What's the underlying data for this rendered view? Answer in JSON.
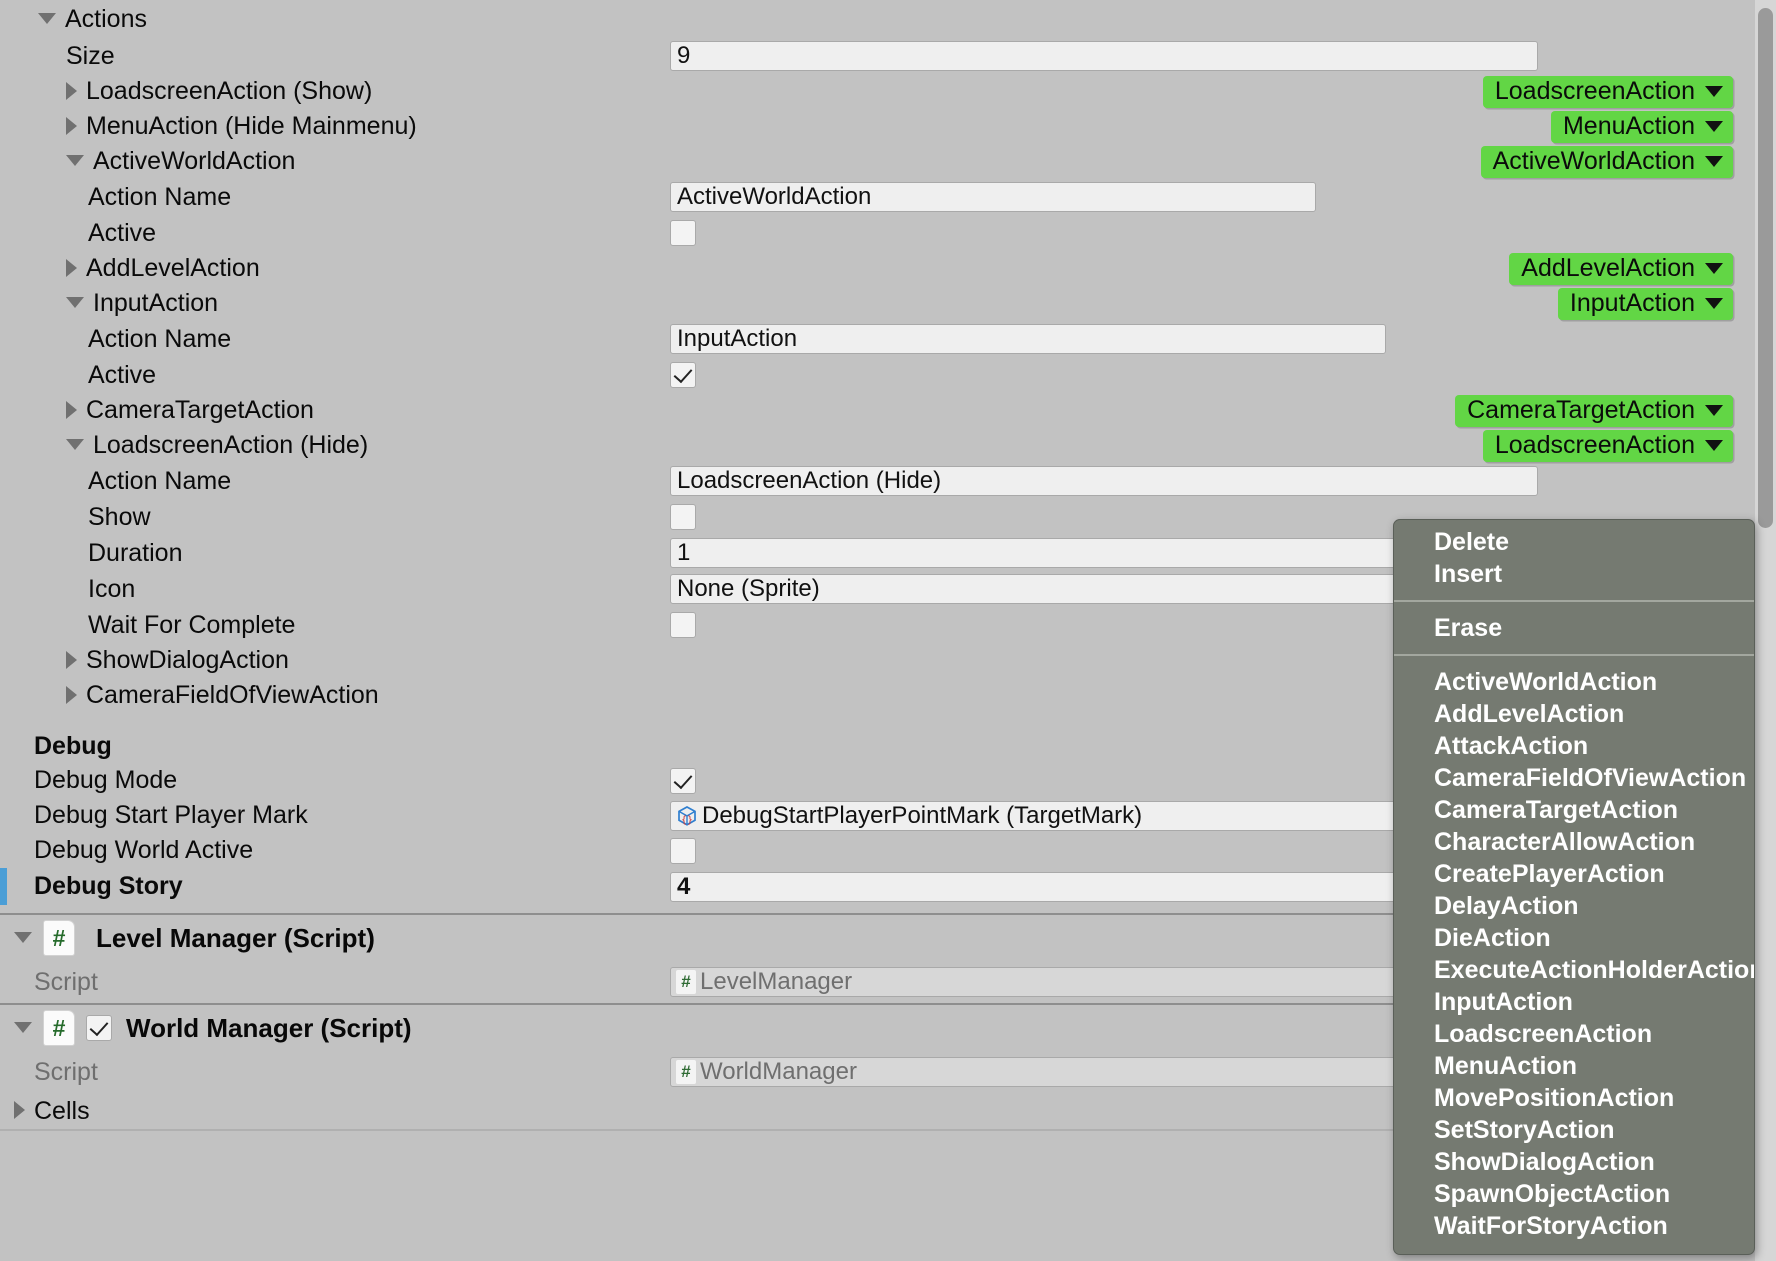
{
  "inspector": {
    "array_header": {
      "label": "Actions",
      "expanded": true
    },
    "size_row": {
      "label": "Size",
      "value": "9"
    },
    "elements": [
      {
        "label": "LoadscreenAction (Show)",
        "expanded": false,
        "type_button": "LoadscreenAction"
      },
      {
        "label": "MenuAction (Hide Mainmenu)",
        "expanded": false,
        "type_button": "MenuAction"
      },
      {
        "label": "ActiveWorldAction",
        "expanded": true,
        "type_button": "ActiveWorldAction",
        "fields": [
          {
            "label": "Action Name",
            "widget": "text",
            "value": "ActiveWorldAction"
          },
          {
            "label": "Active",
            "widget": "checkbox",
            "value": false
          }
        ]
      },
      {
        "label": "AddLevelAction",
        "expanded": false,
        "type_button": "AddLevelAction"
      },
      {
        "label": "InputAction",
        "expanded": true,
        "type_button": "InputAction",
        "fields": [
          {
            "label": "Action Name",
            "widget": "text",
            "value": "InputAction"
          },
          {
            "label": "Active",
            "widget": "checkbox",
            "value": true
          }
        ]
      },
      {
        "label": "CameraTargetAction",
        "expanded": false,
        "type_button": "CameraTargetAction"
      },
      {
        "label": "LoadscreenAction (Hide)",
        "expanded": true,
        "type_button": "LoadscreenAction",
        "fields": [
          {
            "label": "Action Name",
            "widget": "text",
            "value": "LoadscreenAction (Hide)"
          },
          {
            "label": "Show",
            "widget": "checkbox",
            "value": false
          },
          {
            "label": "Duration",
            "widget": "text",
            "value": "1"
          },
          {
            "label": "Icon",
            "widget": "text",
            "value": "None (Sprite)"
          },
          {
            "label": "Wait For Complete",
            "widget": "checkbox",
            "value": false
          }
        ]
      },
      {
        "label": "ShowDialogAction",
        "expanded": false,
        "type_button": null
      },
      {
        "label": "CameraFieldOfViewAction",
        "expanded": false,
        "type_button": null
      }
    ],
    "debug_section": {
      "header": "Debug",
      "rows": [
        {
          "label": "Debug Mode",
          "widget": "checkbox",
          "value": true,
          "bold": false,
          "override": false
        },
        {
          "label": "Debug Start Player Mark",
          "widget": "object",
          "value": "DebugStartPlayerPointMark (TargetMark)",
          "icon": "prefab-icon",
          "bold": false,
          "override": false
        },
        {
          "label": "Debug World Active",
          "widget": "checkbox",
          "value": false,
          "bold": false,
          "override": false
        },
        {
          "label": "Debug Story",
          "widget": "text",
          "value": "4",
          "bold": true,
          "override": true
        }
      ]
    },
    "components": [
      {
        "title": "Level Manager (Script)",
        "expanded": true,
        "has_enable_checkbox": false,
        "enabled": false,
        "icon": "cs-script-icon",
        "rows": [
          {
            "label": "Script",
            "widget": "object-readonly",
            "value": "LevelManager",
            "icon": "cs-script-icon"
          }
        ]
      },
      {
        "title": "World Manager (Script)",
        "expanded": true,
        "has_enable_checkbox": true,
        "enabled": true,
        "icon": "cs-script-icon",
        "rows": [
          {
            "label": "Script",
            "widget": "object-readonly",
            "value": "WorldManager",
            "icon": "cs-script-icon"
          },
          {
            "label": "Cells",
            "widget": "foldout",
            "value": "",
            "expanded": false
          }
        ]
      }
    ]
  },
  "context_menu": {
    "top_items": [
      "Delete",
      "Insert"
    ],
    "erase_item": "Erase",
    "action_types": [
      "ActiveWorldAction",
      "AddLevelAction",
      "AttackAction",
      "CameraFieldOfViewAction",
      "CameraTargetAction",
      "CharacterAllowAction",
      "CreatePlayerAction",
      "DelayAction",
      "DieAction",
      "ExecuteActionHolderAction",
      "InputAction",
      "LoadscreenAction",
      "MenuAction",
      "MovePositionAction",
      "SetStoryAction",
      "ShowDialogAction",
      "SpawnObjectAction",
      "WaitForStoryAction"
    ]
  },
  "colors": {
    "background": "#c2c2c2",
    "field_background": "#efefef",
    "green_button": "#62d645",
    "menu_background": "#757a71",
    "override_marker": "#4b9ed6",
    "script_icon_green": "#256b2b"
  }
}
